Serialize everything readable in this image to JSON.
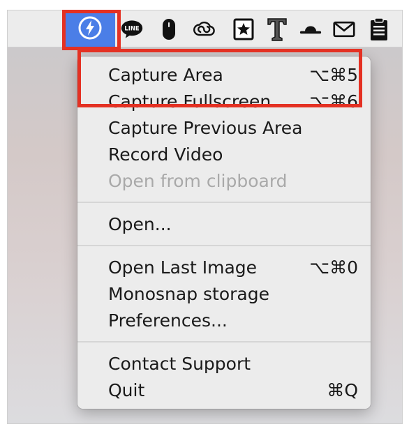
{
  "menubar": {
    "icons": [
      {
        "name": "monosnap-icon",
        "highlighted": true
      },
      {
        "name": "line-icon",
        "label": "LINE"
      },
      {
        "name": "mouse-icon"
      },
      {
        "name": "creative-cloud-icon"
      },
      {
        "name": "star-book-icon"
      },
      {
        "name": "typeface-icon"
      },
      {
        "name": "hat-icon"
      },
      {
        "name": "mail-icon"
      },
      {
        "name": "clipboard-icon"
      }
    ]
  },
  "menu": {
    "items": [
      {
        "label": "Capture Area",
        "shortcut": "⌥⌘5"
      },
      {
        "label": "Capture Fullscreen",
        "shortcut": "⌥⌘6"
      },
      {
        "label": "Capture Previous Area",
        "shortcut": ""
      },
      {
        "label": "Record Video",
        "shortcut": ""
      },
      {
        "label": "Open from clipboard",
        "shortcut": "",
        "disabled": true
      },
      {
        "label": "Open...",
        "shortcut": ""
      },
      {
        "label": "Open Last Image",
        "shortcut": "⌥⌘0"
      },
      {
        "label": "Monosnap storage",
        "shortcut": ""
      },
      {
        "label": "Preferences...",
        "shortcut": ""
      },
      {
        "label": "Contact Support",
        "shortcut": ""
      },
      {
        "label": "Quit",
        "shortcut": "⌘Q"
      }
    ]
  },
  "colors": {
    "highlight_border": "#e43123",
    "monosnap_background": "#4b7ee7",
    "disabled_text": "#a9a9a9"
  }
}
